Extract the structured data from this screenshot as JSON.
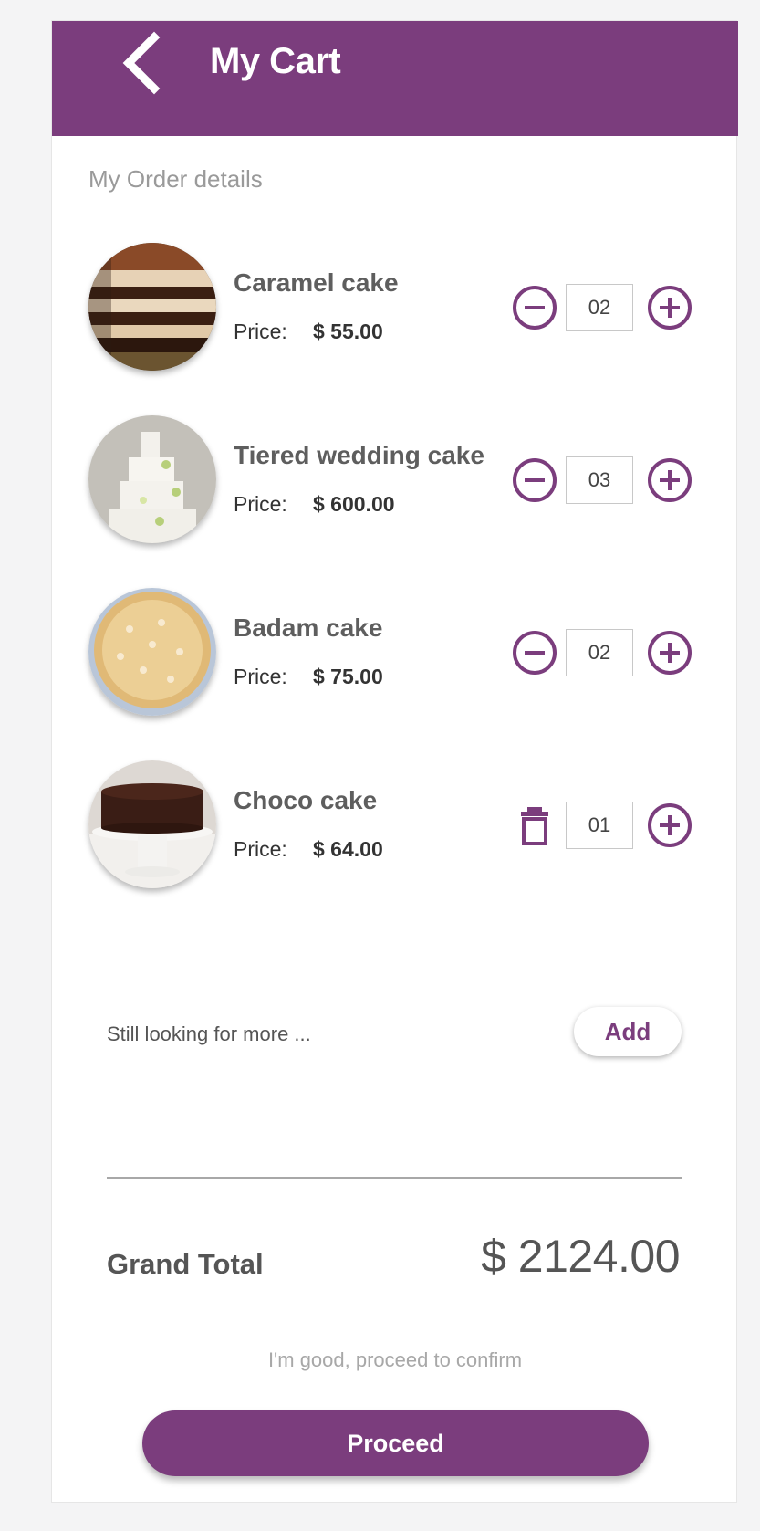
{
  "header": {
    "title": "My Cart",
    "back_icon": "chevron-left-icon"
  },
  "section_title": "My Order details",
  "items": [
    {
      "name": "Caramel cake",
      "price_label": "Price:",
      "price": "$ 55.00",
      "quantity": "02",
      "left_control": "minus-circle-icon",
      "right_control": "plus-circle-icon"
    },
    {
      "name": "Tiered wedding cake",
      "price_label": "Price:",
      "price": "$ 600.00",
      "quantity": "03",
      "left_control": "minus-circle-icon",
      "right_control": "plus-circle-icon"
    },
    {
      "name": "Badam cake",
      "price_label": "Price:",
      "price": "$ 75.00",
      "quantity": "02",
      "left_control": "minus-circle-icon",
      "right_control": "plus-circle-icon"
    },
    {
      "name": "Choco cake",
      "price_label": "Price:",
      "price": "$ 64.00",
      "quantity": "01",
      "left_control": "trash-icon",
      "right_control": "plus-circle-icon"
    }
  ],
  "more": {
    "text": "Still looking for more ...",
    "add_label": "Add"
  },
  "total": {
    "label": "Grand Total",
    "value": "$ 2124.00"
  },
  "footer": {
    "hint": "I'm good, proceed to confirm",
    "proceed_label": "Proceed"
  },
  "colors": {
    "brand": "#7b3d7d",
    "text": "#555555",
    "muted": "#9a9a9a"
  }
}
